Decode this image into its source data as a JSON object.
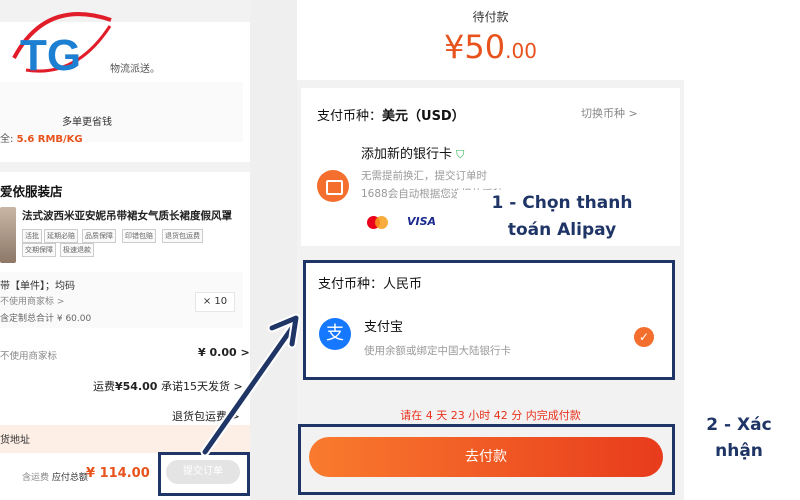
{
  "left": {
    "shipping_note": "物流派送。",
    "promo": "多单更省钱",
    "rate_prefix": "全:",
    "rate_value": "5.6 RMB/KG",
    "shop_name": "爱依服装店",
    "product_title": "法式波西米亚安妮吊带裙女气质长裙度假风罩",
    "tags": [
      "活批",
      "延期必赔",
      "品质保障",
      "印错包赔",
      "退货包运费",
      "交期保障",
      "极速退款"
    ],
    "variant": "带【单件】；均码",
    "brand_note": "不使用商家标 >",
    "subtotal": "含定制总合计 ¥ 60.00",
    "quantity": "× 10",
    "brand_row_label": "不使用商家标",
    "brand_row_value": "¥ 0.00 >",
    "shipping_prefix": "运费",
    "shipping_value": "¥54.00",
    "shipping_suffix": "承诺15天发货 >",
    "return_label": "退货包运费 >",
    "address_label": "货地址",
    "total_prefix": "含运费",
    "total_label": "应付总额",
    "total_amount": "¥ 114.00",
    "submit_label": "提交订单"
  },
  "payment": {
    "pending_label": "待付款",
    "amount_main": "¥50",
    "amount_cents": ".00",
    "usd_title_prefix": "支付币种：",
    "usd_title_value": "美元（USD）",
    "switch_currency": "切换币种 >",
    "bank_title": "添加新的银行卡",
    "bank_desc": "无需提前换汇，提交订单时1688会自动根据您选择的币种",
    "visa": "VISA",
    "rmb_title": "支付币种：人民币",
    "alipay_name": "支付宝",
    "alipay_desc": "使用余额或绑定中国大陆银行卡",
    "countdown": "请在 4 天 23 小时 42 分 内完成付款",
    "pay_button": "去付款"
  },
  "annotations": {
    "step1_line1": "1 - Chọn thanh",
    "step1_line2": "toán Alipay",
    "step2_line1": "2 - Xác",
    "step2_line2": "nhận"
  },
  "colors": {
    "accent": "#e8521c",
    "annotation": "#1f3566",
    "alipay": "#1677ff"
  }
}
